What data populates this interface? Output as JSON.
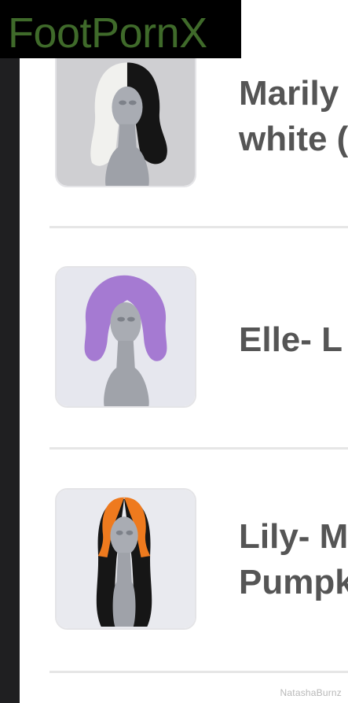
{
  "watermark": {
    "text": "FootPornX"
  },
  "products": [
    {
      "title_lines": [
        "Marily",
        "white ("
      ],
      "image": "wig-half-white-half-black"
    },
    {
      "title_lines": [
        "Elle- L"
      ],
      "image": "wig-lavender-wavy"
    },
    {
      "title_lines": [
        "Lily- M",
        "Pumpk"
      ],
      "image": "wig-orange-black-long"
    }
  ],
  "footer": {
    "credit": "NatashaBurnz"
  },
  "colors": {
    "title": "#555555",
    "divider": "#e6e6e6",
    "watermark_text": "#3f6a2a"
  }
}
